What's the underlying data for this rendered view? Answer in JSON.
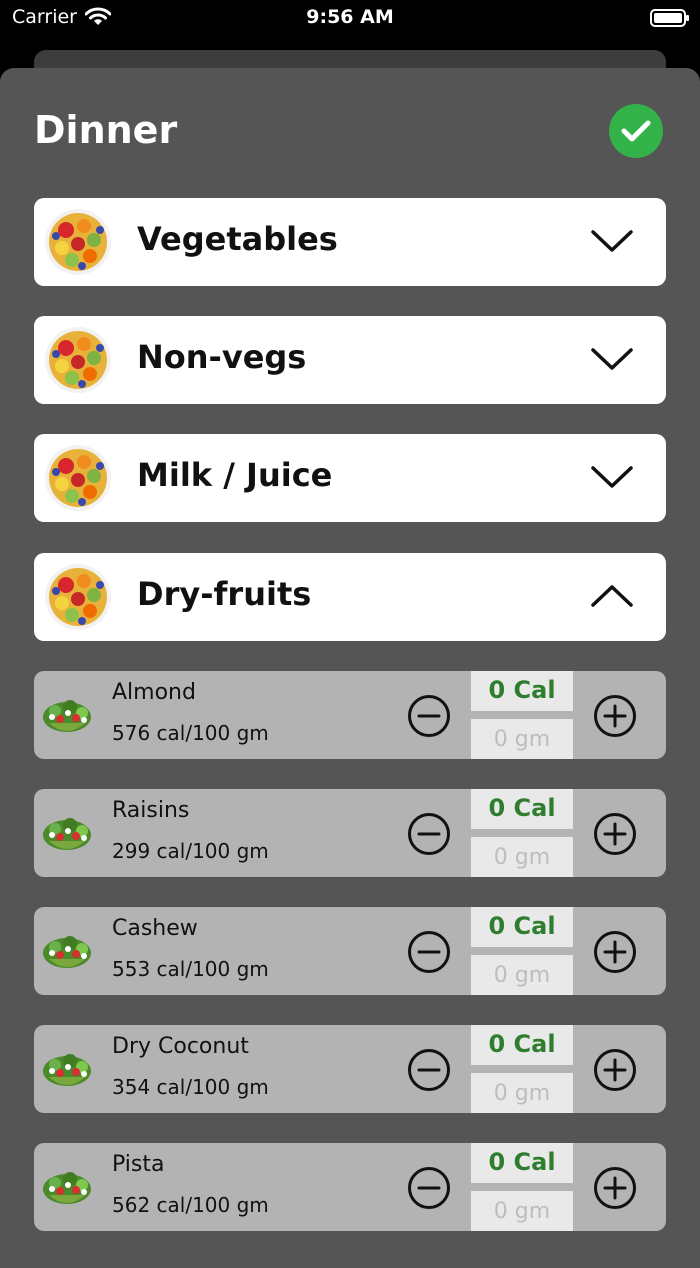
{
  "status_bar": {
    "carrier": "Carrier",
    "time": "9:56 AM"
  },
  "title": "Dinner",
  "categories": [
    {
      "label": "Vegetables",
      "expanded": false
    },
    {
      "label": "Non-vegs",
      "expanded": false
    },
    {
      "label": "Milk / Juice",
      "expanded": false
    },
    {
      "label": "Dry-fruits",
      "expanded": true
    }
  ],
  "foods": [
    {
      "name": "Almond",
      "rate": "576 cal/100 gm",
      "calories": "0 Cal",
      "grams": "0 gm"
    },
    {
      "name": "Raisins",
      "rate": "299 cal/100 gm",
      "calories": "0 Cal",
      "grams": "0 gm"
    },
    {
      "name": "Cashew",
      "rate": "553 cal/100 gm",
      "calories": "0 Cal",
      "grams": "0 gm"
    },
    {
      "name": "Dry Coconut",
      "rate": "354 cal/100 gm",
      "calories": "0 Cal",
      "grams": "0 gm"
    },
    {
      "name": "Pista",
      "rate": "562 cal/100 gm",
      "calories": "0 Cal",
      "grams": "0 gm"
    }
  ],
  "colors": {
    "accent_green": "#34b24a",
    "calorie_text": "#2f7d2f",
    "sheet": "#555555",
    "row": "#b3b3b3"
  },
  "icons": {
    "check": "checkmark-icon",
    "collapsed": "chevron-down-icon",
    "expanded": "chevron-up-icon",
    "minus": "minus-circle-icon",
    "plus": "plus-circle-icon"
  }
}
